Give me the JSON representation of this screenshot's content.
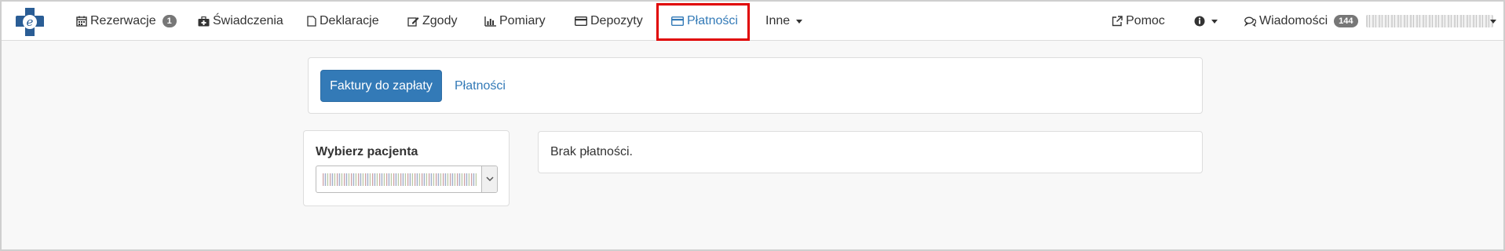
{
  "navbar": {
    "logo_letter": "e",
    "items": [
      {
        "label": "Rezerwacje",
        "badge": "1",
        "icon": "calendar-icon"
      },
      {
        "label": "Świadczenia",
        "icon": "medkit-icon"
      },
      {
        "label": "Deklaracje",
        "icon": "file-icon"
      },
      {
        "label": "Zgody",
        "icon": "edit-icon"
      },
      {
        "label": "Pomiary",
        "icon": "bar-chart-icon"
      },
      {
        "label": "Depozyty",
        "icon": "credit-card-icon"
      },
      {
        "label": "Płatności",
        "icon": "credit-card-icon",
        "active": true
      },
      {
        "label": "Inne",
        "icon": "caret-down-icon"
      }
    ],
    "right": {
      "help_label": "Pomoc",
      "help_icon": "external-link-icon",
      "info_icon": "info-circle-icon",
      "messages_label": "Wiadomości",
      "messages_badge": "144",
      "messages_icon": "comments-icon"
    }
  },
  "tabs": {
    "primary_label": "Faktury do zapłaty",
    "secondary_label": "Płatności"
  },
  "patient": {
    "label": "Wybierz pacjenta"
  },
  "content": {
    "message": "Brak płatności."
  },
  "colors": {
    "accent": "#337ab7",
    "highlight": "#e00000",
    "badge": "#777777"
  }
}
